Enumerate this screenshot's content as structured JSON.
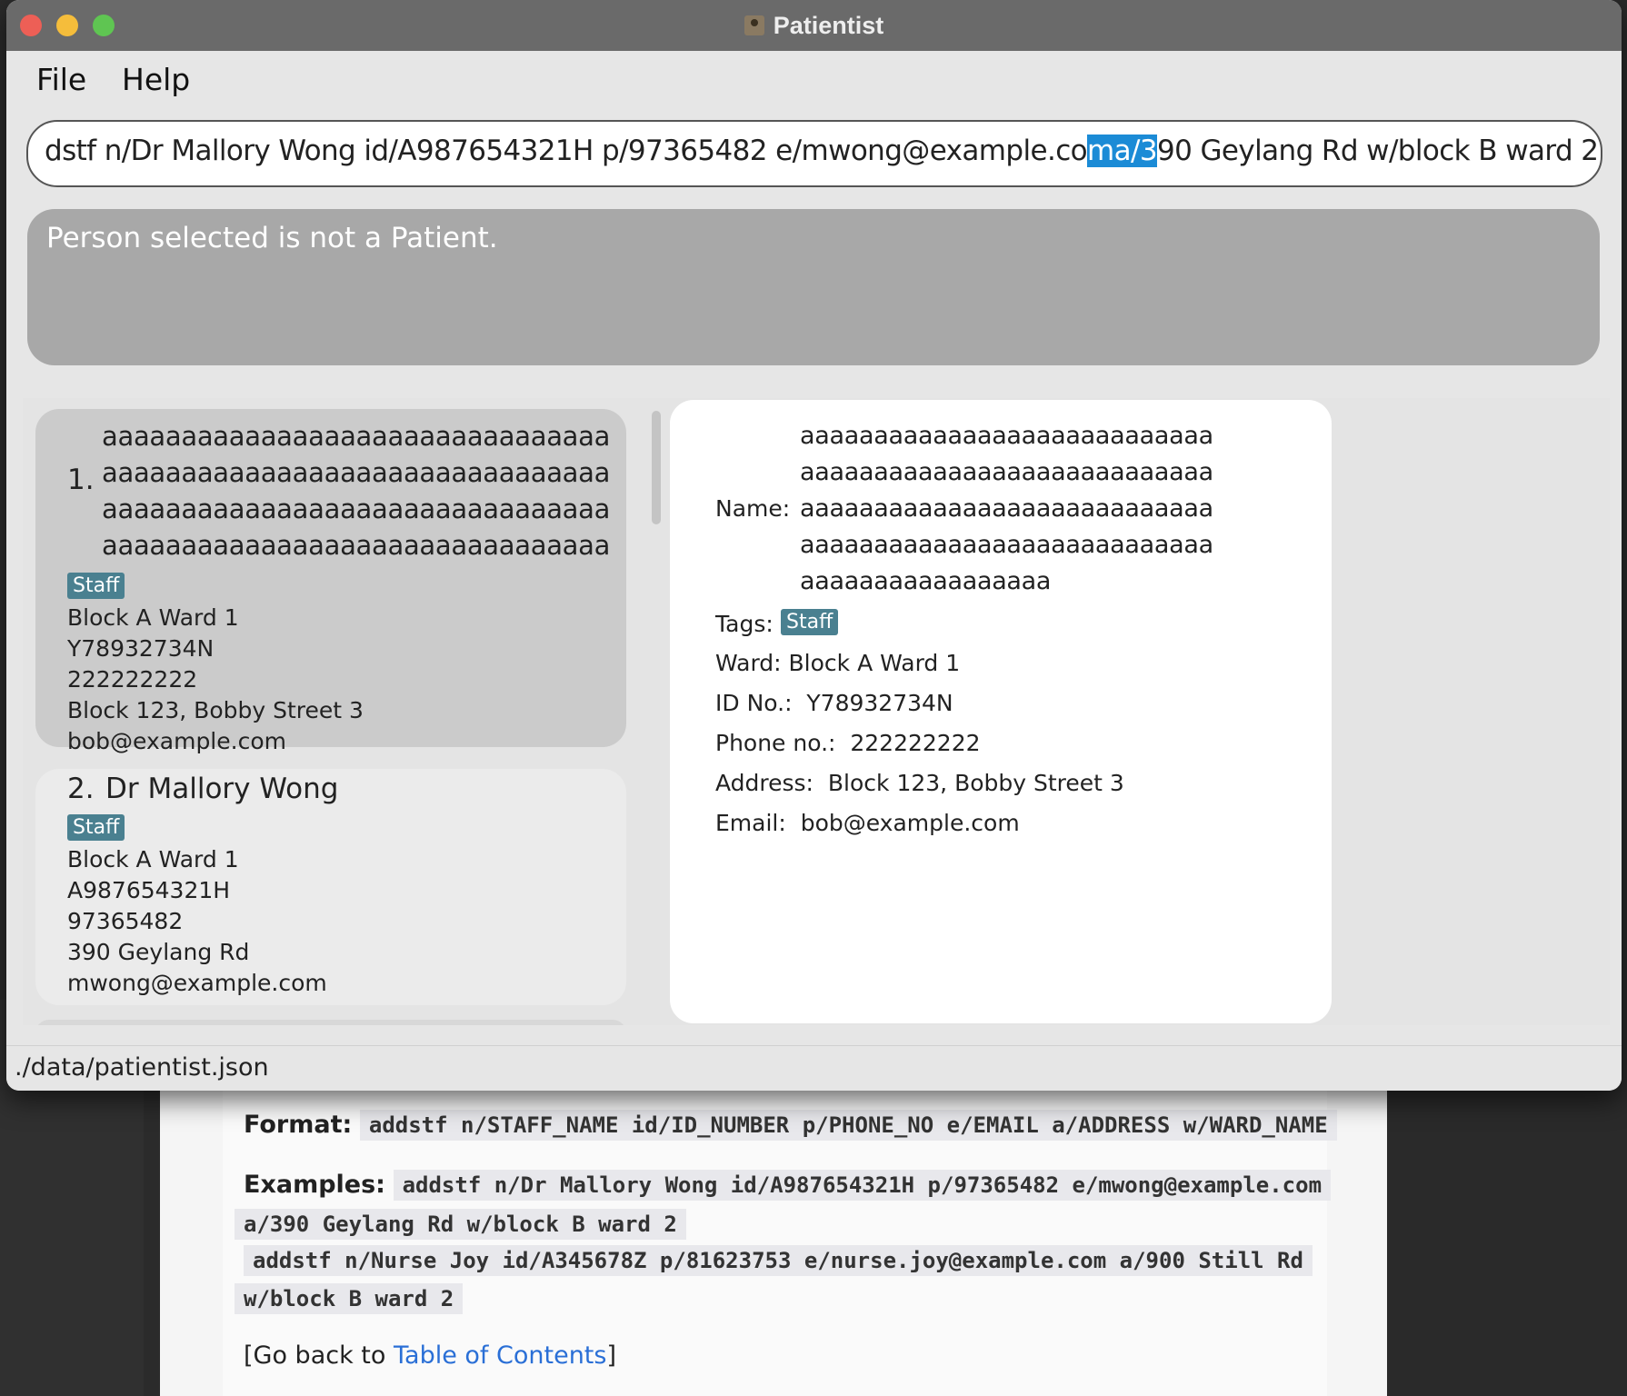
{
  "window": {
    "title": "Patientist"
  },
  "menu": {
    "file": "File",
    "help": "Help"
  },
  "command_box": {
    "text_before": "dstf n/Dr Mallory Wong id/A987654321H p/97365482 e/mwong@example.co",
    "text_selected": "ma/3",
    "text_after": "90 Geylang Rd w/block B ward 2"
  },
  "result_display": {
    "text": "Person selected is not a Patient."
  },
  "person_list": [
    {
      "index": "1.",
      "name": "aaaaaaaaaaaaaaaaaaaaaaaaaaaaaaaaaaaaaaaaaaaaaaaaaaaaaaaaaaaaaaaaaaaaaaaaaaaaaaaaaaaaaaaaaaaaaaaaaaaaaaaaaaaaaaaaaaaaaaaaaaaaaaaaa",
      "tag": "Staff",
      "ward": "Block A Ward 1",
      "id": "Y78932734N",
      "phone": "222222222",
      "address": "Block 123, Bobby Street 3",
      "email": "bob@example.com"
    },
    {
      "index": "2.",
      "name": "Dr Mallory Wong",
      "tag": "Staff",
      "ward": "Block A Ward 1",
      "id": "A987654321H",
      "phone": "97365482",
      "address": "390 Geylang Rd",
      "email": "mwong@example.com"
    }
  ],
  "detail": {
    "name_label": "Name:",
    "name_value": "aaaaaaaaaaaaaaaaaaaaaaaaaaaaaaaaaaaaaaaaaaaaaaaaaaaaaaaaaaaaaaaaaaaaaaaaaaaaaaaaaaaaaaaaaaaaaaaaaaaaaaaaaaaaaaaaaaaaaaaaaaaaaaaaa",
    "tags_label": "Tags:",
    "tag": "Staff",
    "ward_label": "Ward:",
    "ward_value": "Block A Ward 1",
    "id_label": "ID No.:",
    "id_value": "Y78932734N",
    "phone_label": "Phone no.:",
    "phone_value": "222222222",
    "address_label": "Address:",
    "address_value": "Block 123, Bobby Street 3",
    "email_label": "Email:",
    "email_value": "bob@example.com"
  },
  "status_bar": {
    "path": "./data/patientist.json"
  },
  "doc": {
    "format_label": "Format:",
    "format_code": "addstf n/STAFF_NAME id/ID_NUMBER p/PHONE_NO e/EMAIL a/ADDRESS w/WARD_NAME",
    "examples_label": "Examples:",
    "example1_line1": "addstf n/Dr Mallory Wong id/A987654321H p/97365482 e/mwong@example.com",
    "example1_line2": "a/390 Geylang Rd w/block B ward 2",
    "example2_line1": "addstf n/Nurse Joy id/A345678Z p/81623753 e/nurse.joy@example.com a/900 Still Rd",
    "example2_line2": "w/block B ward 2",
    "back_prefix": "[Go back to ",
    "back_link": "Table of Contents",
    "back_suffix": "]"
  },
  "colors": {
    "titlebar": "#6a6a6a",
    "selection": "#1b8bd6",
    "tag": "#4a8090",
    "result_bg": "#a8a8a8",
    "link": "#2a6fd6"
  }
}
